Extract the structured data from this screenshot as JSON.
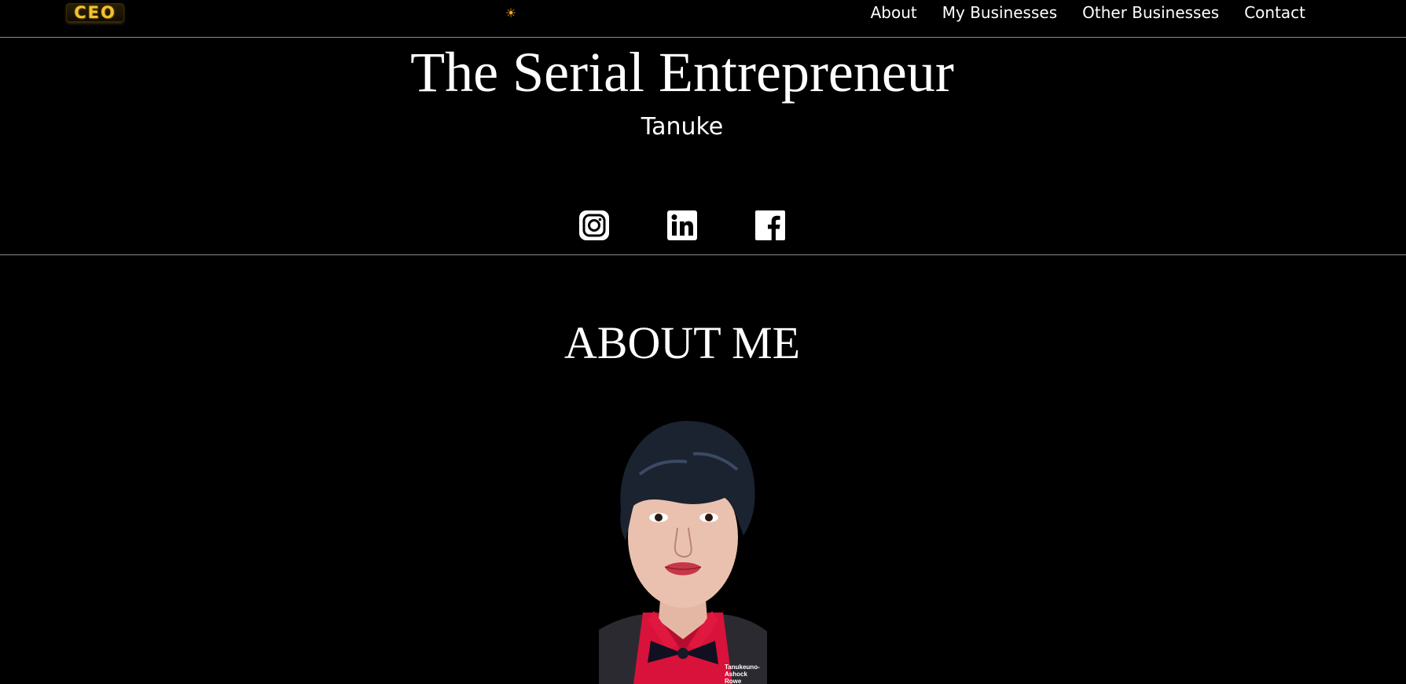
{
  "header": {
    "logo_text": "CEO",
    "theme_toggle_glyph": "☀",
    "nav": [
      {
        "label": "About"
      },
      {
        "label": "My Businesses"
      },
      {
        "label": "Other Businesses"
      },
      {
        "label": "Contact"
      }
    ]
  },
  "hero": {
    "title": "The Serial Entrepreneur",
    "subtitle": "Tanuke",
    "social_icons": [
      "instagram-icon",
      "linkedin-icon",
      "facebook-icon"
    ]
  },
  "about": {
    "heading": "ABOUT ME",
    "photo_caption": "Tanukeuno-Ashock Rowe"
  },
  "colors": {
    "background": "#000000",
    "text": "#ffffff",
    "divider": "#8a8a8a",
    "logo_gold": "#f2c230",
    "sun": "#f4a31a"
  }
}
